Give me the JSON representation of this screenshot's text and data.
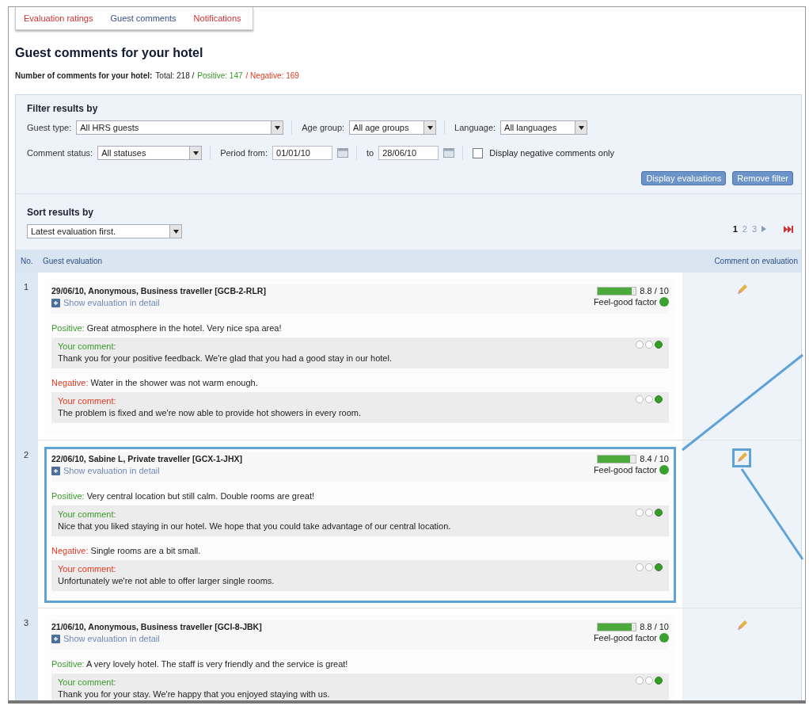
{
  "tabs": [
    {
      "label": "Evaluation ratings",
      "selected": false
    },
    {
      "label": "Guest comments",
      "selected": true
    },
    {
      "label": "Notifications",
      "selected": false
    }
  ],
  "title": "Guest comments for your hotel",
  "summary": {
    "label": "Number of comments for your hotel:",
    "total": "Total: 218 /",
    "positive": "Positive: 147",
    "negative": "/ Negative: 169"
  },
  "filter": {
    "title": "Filter results by",
    "rows": [
      {
        "fields": [
          {
            "kind": "select",
            "label": "Guest type:",
            "value": "All HRS guests"
          },
          {
            "kind": "select",
            "label": "Age group:",
            "value": "All age groups"
          },
          {
            "kind": "select",
            "label": "Language:",
            "value": "All languages"
          }
        ]
      },
      {
        "fields": [
          {
            "kind": "select",
            "label": "Comment status:",
            "value": "All statuses"
          },
          {
            "kind": "date",
            "label": "Period from:",
            "value": "01/01/10"
          },
          {
            "kind": "date",
            "label": "to",
            "value": "28/06/10"
          },
          {
            "kind": "checkbox",
            "label": "Display negative comments only",
            "checked": false
          }
        ]
      }
    ],
    "buttons": [
      "Display evaluations",
      "Remove filter"
    ]
  },
  "sort": {
    "title": "Sort results by",
    "value": "Latest evaluation first."
  },
  "pages": [
    {
      "label": "1",
      "selected": true
    },
    {
      "label": "2",
      "selected": false
    },
    {
      "label": "3",
      "selected": false
    }
  ],
  "columns": [
    "No.",
    "Guest evaluation",
    "Comment on evaluation"
  ],
  "entries": [
    {
      "number": "1",
      "header": "29/06/10, Anonymous, Business traveller [GCB-2-RLR]",
      "link": "Show evaluation in detail",
      "score": "8.8 / 10",
      "level": 0.88,
      "factor": "Feel-good factor",
      "highlighted": false,
      "items": [
        {
          "kind": "positive",
          "label": "Positive:",
          "text": "Great atmosphere in the hotel. Very nice spa area!"
        },
        {
          "kind": "positive_reply",
          "label": "Your comment:",
          "text": "Thank you for your positive feedback. We're glad that you had a good stay in our hotel.",
          "dots": [
            {
              "selected": false
            },
            {
              "selected": false
            },
            {
              "selected": true
            }
          ]
        },
        {
          "kind": "negative",
          "label": "Negative:",
          "text": "Water in the shower was not warm enough."
        },
        {
          "kind": "negative_reply",
          "label": "Your comment:",
          "text": "The problem is fixed and we're now able to provide hot showers in every room.",
          "dots": [
            {
              "selected": false
            },
            {
              "selected": false
            },
            {
              "selected": true
            }
          ]
        }
      ]
    },
    {
      "number": "2",
      "header": "22/06/10, Sabine L, Private traveller [GCX-1-JHX]",
      "link": "Show evaluation in detail",
      "score": "8.4 / 10",
      "level": 0.84,
      "factor": "Feel-good factor",
      "highlighted": true,
      "items": [
        {
          "kind": "positive",
          "label": "Positive:",
          "text": "Very central location but still calm. Double rooms are great!"
        },
        {
          "kind": "positive_reply",
          "label": "Your comment:",
          "text": "Nice that you liked staying in our hotel. We hope that you could take advantage of our central location.",
          "dots": [
            {
              "selected": false
            },
            {
              "selected": false
            },
            {
              "selected": true
            }
          ]
        },
        {
          "kind": "negative",
          "label": "Negative:",
          "text": "Single rooms are a bit small."
        },
        {
          "kind": "negative_reply",
          "label": "Your comment:",
          "text": "Unfortunately we're not able to offer larger single rooms.",
          "dots": [
            {
              "selected": false
            },
            {
              "selected": false
            },
            {
              "selected": true
            }
          ]
        }
      ]
    },
    {
      "number": "3",
      "header": "21/06/10, Anonymous, Business traveller [GCI-8-JBK]",
      "link": "Show evaluation in detail",
      "score": "8.8 / 10",
      "level": 0.88,
      "factor": "Feel-good factor",
      "highlighted": false,
      "items": [
        {
          "kind": "positive",
          "label": "Positive:",
          "text": "A very lovely hotel. The staff is very friendly and the service is great!"
        },
        {
          "kind": "positive_reply",
          "label": "Your comment:",
          "text": "Thank you for your stay. We're happy that you enjoyed staying with us.",
          "dots": [
            {
              "selected": false
            },
            {
              "selected": false
            },
            {
              "selected": true
            }
          ]
        }
      ]
    }
  ]
}
